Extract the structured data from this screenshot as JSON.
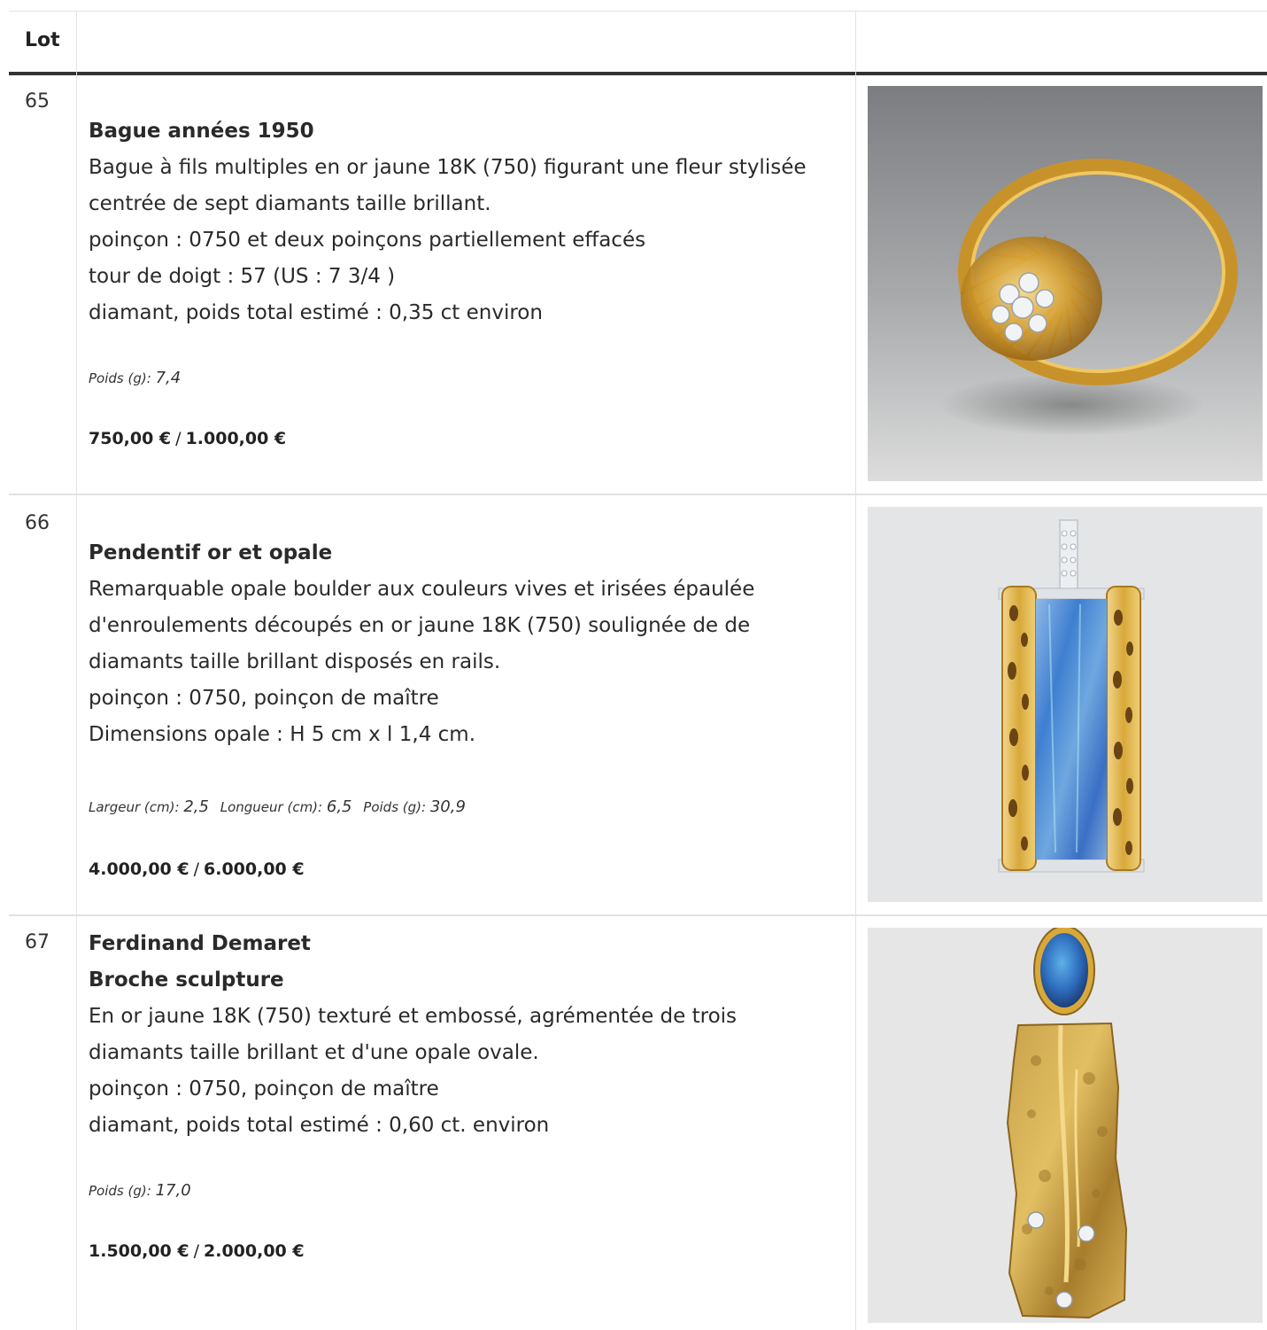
{
  "table": {
    "header": {
      "lot_label": "Lot"
    }
  },
  "lots": [
    {
      "number": "65",
      "title": "Bague années 1950",
      "lines": [
        "Bague à fils multiples en or jaune 18K (750) figurant une fleur stylisée",
        "centrée de sept diamants taille brillant.",
        "poinçon : 0750 et deux poinçons partiellement effacés",
        "tour de doigt : 57 (US : 7 3/4 )",
        "diamant, poids total estimé : 0,35 ct environ"
      ],
      "weight_label": "Poids (g):",
      "weight_value": "7,4",
      "estimate_low": "750,00 €",
      "estimate_high": "1.000,00 €"
    },
    {
      "number": "66",
      "title": "Pendentif or et opale",
      "lines": [
        "Remarquable opale boulder aux couleurs vives et irisées épaulée",
        "d'enroulements découpés en or jaune 18K (750) soulignée de de",
        "diamants taille brillant disposés en rails.",
        "poinçon : 0750, poinçon de maître",
        "Dimensions opale : H 5 cm x l 1,4 cm."
      ],
      "width_label": "Largeur (cm):",
      "width_value": "2,5",
      "length_label": "Longueur (cm):",
      "length_value": "6,5",
      "weight_label": "Poids (g):",
      "weight_value": "30,9",
      "estimate_low": "4.000,00 €",
      "estimate_high": "6.000,00 €"
    },
    {
      "number": "67",
      "artist": "Ferdinand Demaret",
      "title": "Broche sculpture",
      "lines": [
        "En or jaune 18K (750) texturé et embossé, agrémentée de trois",
        "diamants taille brillant et d'une opale ovale.",
        "poinçon : 0750, poinçon de maître",
        "diamant, poids total estimé : 0,60 ct. environ"
      ],
      "weight_label": "Poids (g):",
      "weight_value": "17,0",
      "estimate_low": "1.500,00 €",
      "estimate_high": "2.000,00 €"
    }
  ],
  "estimate_separator": "/",
  "colors": {
    "border": "#e2e2e2",
    "header_rule": "#333333",
    "gold": "#d8a93a",
    "opal_blue": "#4f8fd6"
  }
}
